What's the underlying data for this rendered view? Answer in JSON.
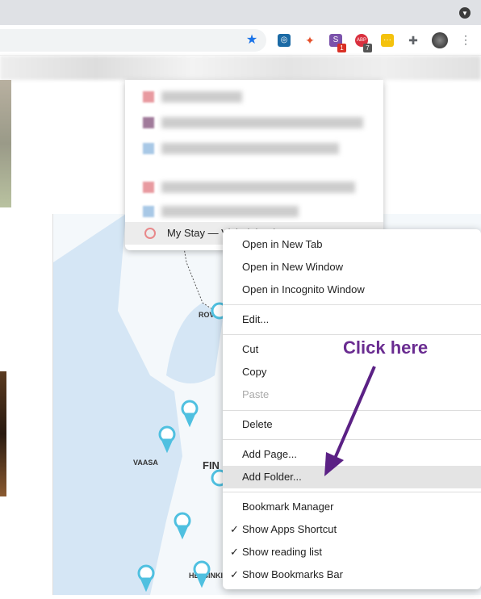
{
  "browser": {
    "extensions": [
      {
        "name": "bookmark-star-icon",
        "color": "#1a73e8"
      },
      {
        "name": "safari-compass-extension-icon",
        "color": "#1b6aa5"
      },
      {
        "name": "red-extension-icon",
        "color": "#e5502b"
      },
      {
        "name": "s-extension-icon",
        "color": "#7b52ab",
        "label": "S",
        "badge": "1"
      },
      {
        "name": "adblock-extension-icon",
        "color": "#d9303e",
        "label": "ABP",
        "badge": "7"
      },
      {
        "name": "yellow-extension-icon",
        "color": "#f4c20d"
      },
      {
        "name": "extensions-puzzle-icon",
        "color": "#5f6368"
      }
    ]
  },
  "bookmark_folder": {
    "item": "My Stay — VisitFinland"
  },
  "map": {
    "labels": [
      "ROV",
      "VAASA",
      "FIN",
      "HELSINKI"
    ]
  },
  "context_menu": {
    "items": [
      {
        "label": "Open in New Tab"
      },
      {
        "label": "Open in New Window"
      },
      {
        "label": "Open in Incognito Window"
      },
      {
        "label": "Edit..."
      },
      {
        "label": "Cut"
      },
      {
        "label": "Copy"
      },
      {
        "label": "Paste",
        "disabled": true
      },
      {
        "label": "Delete"
      },
      {
        "label": "Add Page..."
      },
      {
        "label": "Add Folder...",
        "highlighted": true
      },
      {
        "label": "Bookmark Manager"
      },
      {
        "label": "Show Apps Shortcut",
        "checked": true
      },
      {
        "label": "Show reading list",
        "checked": true
      },
      {
        "label": "Show Bookmarks Bar",
        "checked": true
      }
    ],
    "checkmark": "✓"
  },
  "annotation": {
    "text": "Click here",
    "color": "#6a2c91"
  }
}
